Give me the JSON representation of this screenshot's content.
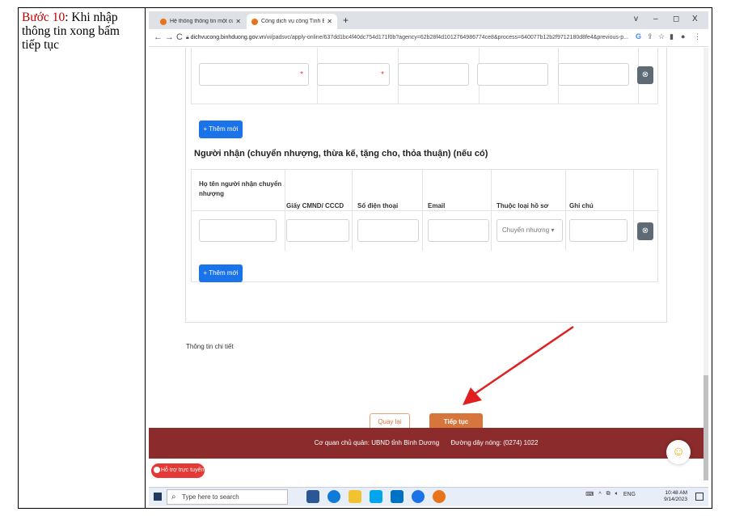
{
  "doc": {
    "step_label": "Bước 10",
    "instruction": ": Khi nhập thông tin xong bấm tiếp tục"
  },
  "browser": {
    "tabs": [
      {
        "title": "Hệ thống thông tin một cửa điện tử"
      },
      {
        "title": "Cổng dịch vụ công Tỉnh Bình Dương"
      }
    ],
    "new_tab": "+",
    "window_controls": [
      "v",
      "–",
      "◻",
      "X"
    ],
    "url_host": "dichvucong.binhduong.gov.vn",
    "url_path": "/vi/padsvc/apply-online/637dd1bc4f40dc754d171f0b?agency=62b28f4d10127649867​74ce8&process=640077b12b2f9712180d8fe4&previous-p..."
  },
  "form": {
    "add_new_label": "+ Thêm mới",
    "section_title": "Người nhận (chuyển nhượng, thừa kế, tặng cho, thỏa thuận) (nếu có)",
    "columns": [
      "Họ tên người nhận chuyển nhượng",
      "Giấy CMND/ CCCD",
      "Số điện thoại",
      "Email",
      "Thuộc loại hồ sơ",
      "Ghi chú"
    ],
    "select_value": "Chuyển nhượng",
    "detail_label": "Thông tin chi tiết",
    "back_label": "Quay lại",
    "next_label": "Tiếp tục"
  },
  "footer": {
    "agency": "Cơ quan chủ quản: UBND tỉnh Bình Dương",
    "hotline": "Đường dây nóng: (0274) 1022"
  },
  "hotline_badge": "Hỗ trợ trực tuyến",
  "taskbar": {
    "search_placeholder": "Type here to search",
    "lang": "ENG",
    "time": "10:48 AM",
    "date": "9/14/2023"
  }
}
